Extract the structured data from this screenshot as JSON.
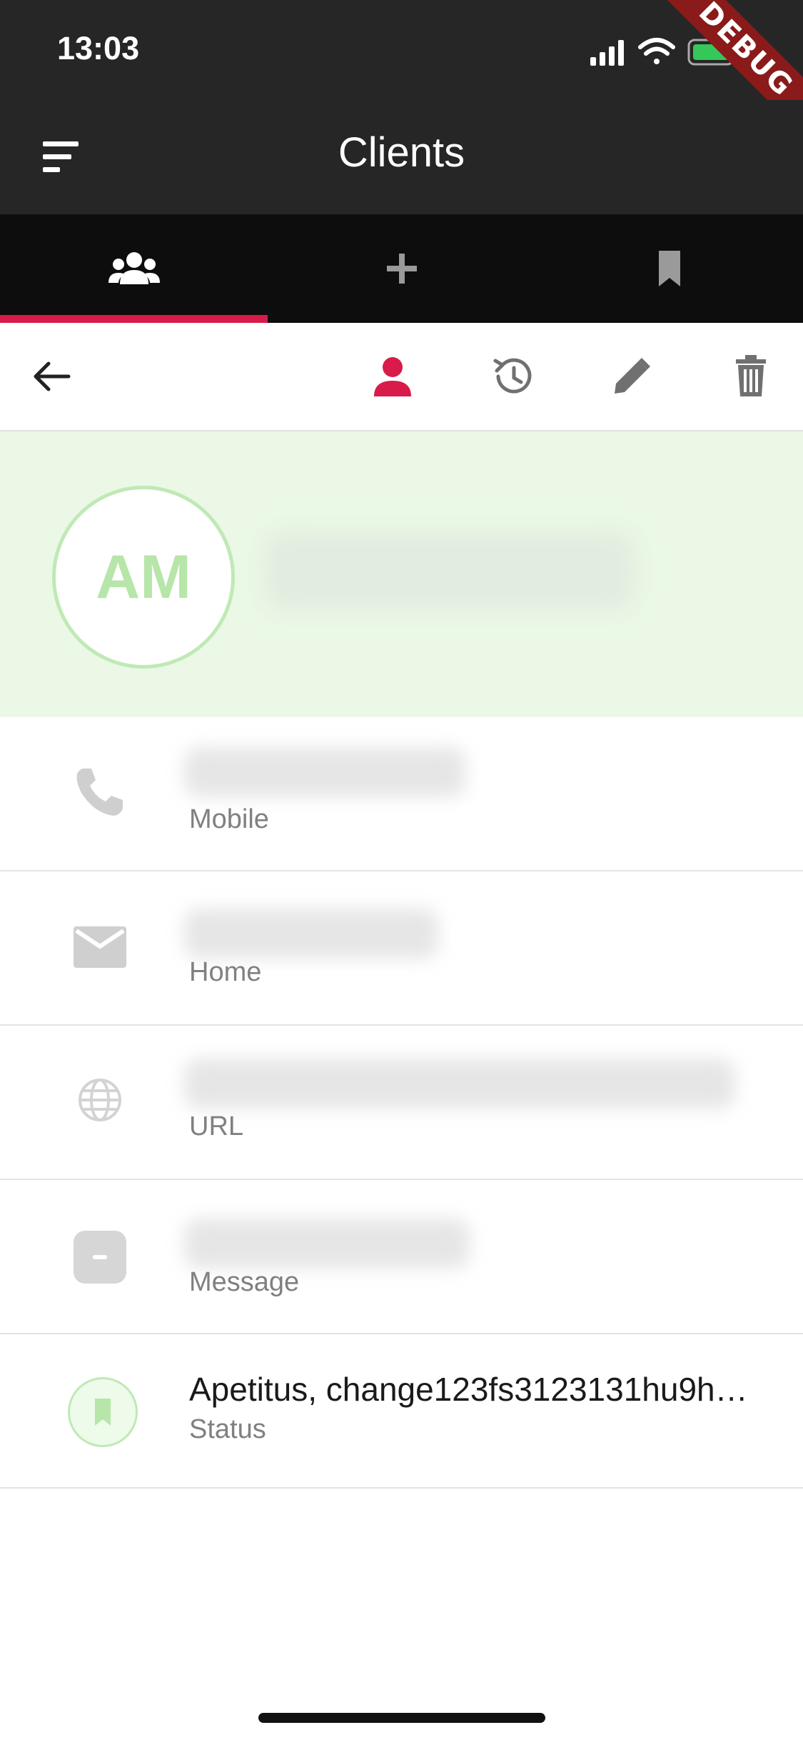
{
  "status_bar": {
    "time": "13:03",
    "debug_label": "DEBUG"
  },
  "app_bar": {
    "title": "Clients"
  },
  "tabs": [
    {
      "icon": "people-icon",
      "selected": true
    },
    {
      "icon": "plus-icon",
      "selected": false
    },
    {
      "icon": "bookmark-icon",
      "selected": false
    }
  ],
  "toolbar": {
    "actions": [
      "back-arrow-icon",
      "person-icon",
      "history-icon",
      "edit-icon",
      "trash-icon"
    ],
    "active": "person-icon"
  },
  "client": {
    "initials": "AM"
  },
  "details": [
    {
      "icon": "phone-icon",
      "label": "Mobile"
    },
    {
      "icon": "mail-icon",
      "label": "Home"
    },
    {
      "icon": "globe-icon",
      "label": "URL"
    },
    {
      "icon": "message-icon",
      "label": "Message"
    },
    {
      "icon": "bookmark-icon",
      "label": "Status",
      "value": "Apetitus, change123fs3123131hu9h…"
    }
  ],
  "colors": {
    "accent": "#d81b4a",
    "bar_dark": "#262626",
    "tab_bg": "#0d0d0d",
    "header_bg": "#ebf8e6",
    "avatar_green": "#b6e6a9"
  }
}
